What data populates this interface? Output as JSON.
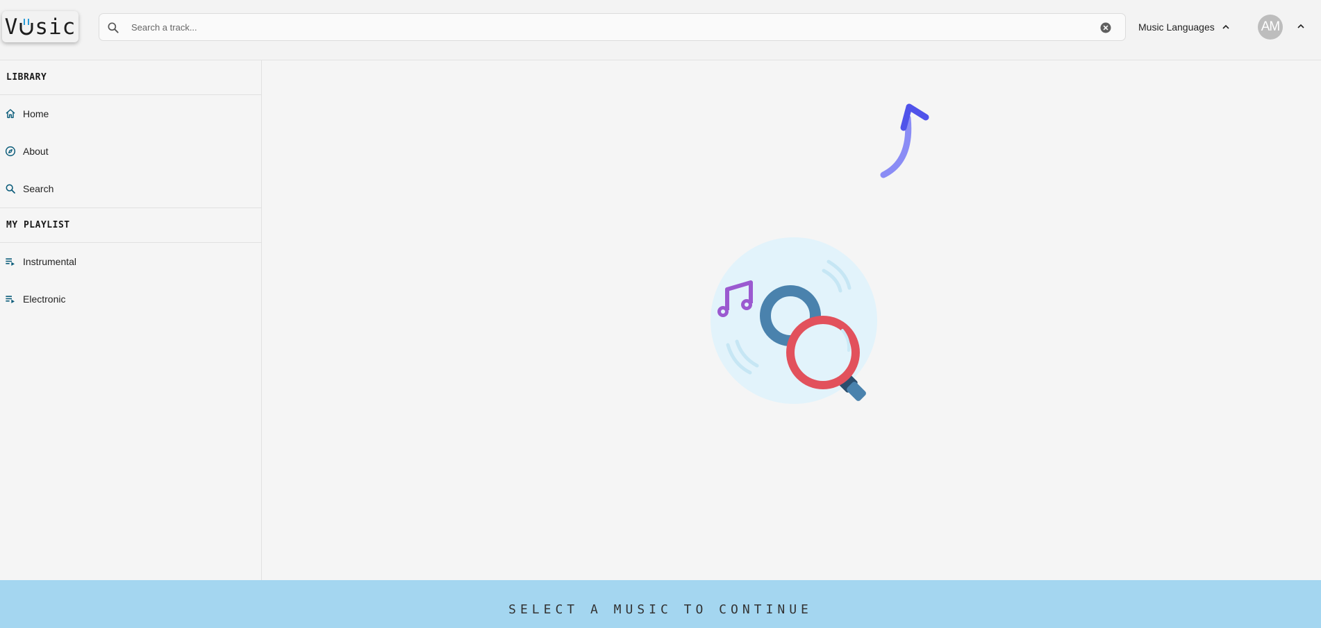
{
  "header": {
    "logo_text_left": "V",
    "logo_text_right": "sic",
    "search": {
      "placeholder": "Search a track...",
      "value": ""
    },
    "language_label": "Music Languages",
    "avatar_initials": "AM"
  },
  "sidebar": {
    "library_title": "LIBRARY",
    "library_items": [
      {
        "label": "Home",
        "icon": "home-icon"
      },
      {
        "label": "About",
        "icon": "compass-icon"
      },
      {
        "label": "Search",
        "icon": "search-icon"
      }
    ],
    "playlist_title": "MY PLAYLIST",
    "playlist_items": [
      {
        "label": "Instrumental",
        "icon": "playlist-icon"
      },
      {
        "label": "Electronic",
        "icon": "playlist-icon"
      }
    ]
  },
  "footer": {
    "message": "SELECT A MUSIC TO CONTINUE"
  },
  "colors": {
    "accent": "#0b5c7a",
    "arrow": "#5b5ef0",
    "footer_bg": "#a4d6f0",
    "magnifier_ring": "#e2515c",
    "disc": "#4a82ad",
    "note": "#9b59d0"
  }
}
